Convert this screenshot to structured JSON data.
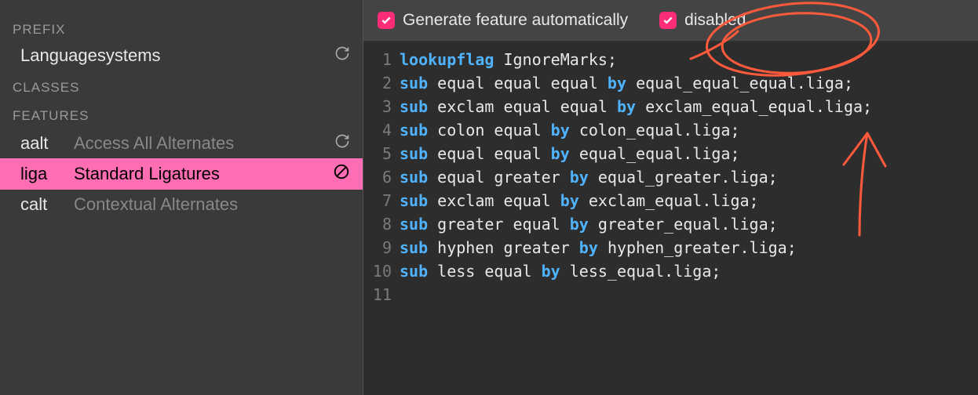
{
  "sidebar": {
    "prefix": {
      "header": "PREFIX",
      "item": {
        "label": "Languagesystems"
      }
    },
    "classes": {
      "header": "CLASSES"
    },
    "features": {
      "header": "FEATURES",
      "items": [
        {
          "tag": "aalt",
          "label": "Access All Alternates",
          "icon": "refresh",
          "selected": false
        },
        {
          "tag": "liga",
          "label": "Standard Ligatures",
          "icon": "disabled",
          "selected": true
        },
        {
          "tag": "calt",
          "label": "Contextual Alternates",
          "icon": "",
          "selected": false
        }
      ]
    }
  },
  "toolbar": {
    "generate": {
      "label": "Generate feature automatically",
      "checked": true
    },
    "disabled": {
      "label": "disabled",
      "checked": true
    }
  },
  "editor": {
    "lines": [
      [
        {
          "t": "kw",
          "v": "lookupflag"
        },
        {
          "t": "sp",
          "v": " "
        },
        {
          "t": "txt",
          "v": "IgnoreMarks;"
        }
      ],
      [
        {
          "t": "kw",
          "v": "sub"
        },
        {
          "t": "sp",
          "v": " "
        },
        {
          "t": "txt",
          "v": "equal equal equal "
        },
        {
          "t": "kw",
          "v": "by"
        },
        {
          "t": "sp",
          "v": " "
        },
        {
          "t": "txt",
          "v": "equal_equal_equal.liga;"
        }
      ],
      [
        {
          "t": "kw",
          "v": "sub"
        },
        {
          "t": "sp",
          "v": " "
        },
        {
          "t": "txt",
          "v": "exclam equal equal "
        },
        {
          "t": "kw",
          "v": "by"
        },
        {
          "t": "sp",
          "v": " "
        },
        {
          "t": "txt",
          "v": "exclam_equal_equal.liga;"
        }
      ],
      [
        {
          "t": "kw",
          "v": "sub"
        },
        {
          "t": "sp",
          "v": " "
        },
        {
          "t": "txt",
          "v": "colon equal "
        },
        {
          "t": "kw",
          "v": "by"
        },
        {
          "t": "sp",
          "v": " "
        },
        {
          "t": "txt",
          "v": "colon_equal.liga;"
        }
      ],
      [
        {
          "t": "kw",
          "v": "sub"
        },
        {
          "t": "sp",
          "v": " "
        },
        {
          "t": "txt",
          "v": "equal equal "
        },
        {
          "t": "kw",
          "v": "by"
        },
        {
          "t": "sp",
          "v": " "
        },
        {
          "t": "txt",
          "v": "equal_equal.liga;"
        }
      ],
      [
        {
          "t": "kw",
          "v": "sub"
        },
        {
          "t": "sp",
          "v": " "
        },
        {
          "t": "txt",
          "v": "equal greater "
        },
        {
          "t": "kw",
          "v": "by"
        },
        {
          "t": "sp",
          "v": " "
        },
        {
          "t": "txt",
          "v": "equal_greater.liga;"
        }
      ],
      [
        {
          "t": "kw",
          "v": "sub"
        },
        {
          "t": "sp",
          "v": " "
        },
        {
          "t": "txt",
          "v": "exclam equal "
        },
        {
          "t": "kw",
          "v": "by"
        },
        {
          "t": "sp",
          "v": " "
        },
        {
          "t": "txt",
          "v": "exclam_equal.liga;"
        }
      ],
      [
        {
          "t": "kw",
          "v": "sub"
        },
        {
          "t": "sp",
          "v": " "
        },
        {
          "t": "txt",
          "v": "greater equal "
        },
        {
          "t": "kw",
          "v": "by"
        },
        {
          "t": "sp",
          "v": " "
        },
        {
          "t": "txt",
          "v": "greater_equal.liga;"
        }
      ],
      [
        {
          "t": "kw",
          "v": "sub"
        },
        {
          "t": "sp",
          "v": " "
        },
        {
          "t": "txt",
          "v": "hyphen greater "
        },
        {
          "t": "kw",
          "v": "by"
        },
        {
          "t": "sp",
          "v": " "
        },
        {
          "t": "txt",
          "v": "hyphen_greater.liga;"
        }
      ],
      [
        {
          "t": "kw",
          "v": "sub"
        },
        {
          "t": "sp",
          "v": " "
        },
        {
          "t": "txt",
          "v": "less equal "
        },
        {
          "t": "kw",
          "v": "by"
        },
        {
          "t": "sp",
          "v": " "
        },
        {
          "t": "txt",
          "v": "less_equal.liga;"
        }
      ],
      []
    ]
  }
}
